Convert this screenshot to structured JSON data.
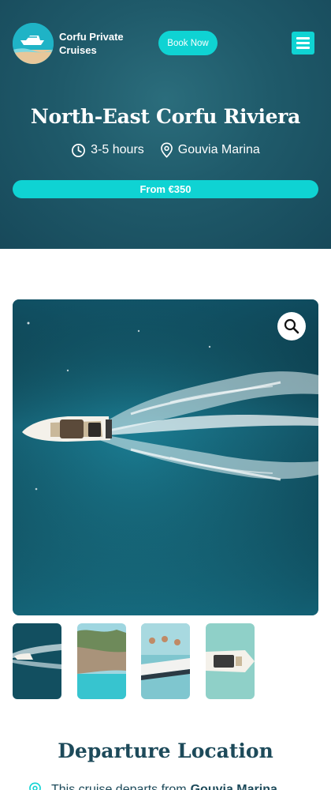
{
  "header": {
    "brand_name": "Corfu Private Cruises",
    "book_button": "Book Now",
    "menu_icon": "hamburger-menu-icon"
  },
  "hero": {
    "title": "North-East Corfu Riviera",
    "duration": "3-5 hours",
    "location": "Gouvia Marina",
    "price": "From €350"
  },
  "gallery": {
    "main_image": "aerial view of speedboat leaving wake on turquoise sea",
    "zoom_icon": "magnifier-icon",
    "thumbnails": [
      "speedboat aerial",
      "rocky coastline bay",
      "people jumping off boat",
      "boat deck seating"
    ]
  },
  "departure": {
    "title": "Departure Location",
    "text": "This cruise departs from",
    "place": "Gouvia Marina"
  },
  "colors": {
    "accent": "#0fd3d3",
    "hero_bg": "#1f5a6a",
    "heading": "#1d4a5a"
  }
}
